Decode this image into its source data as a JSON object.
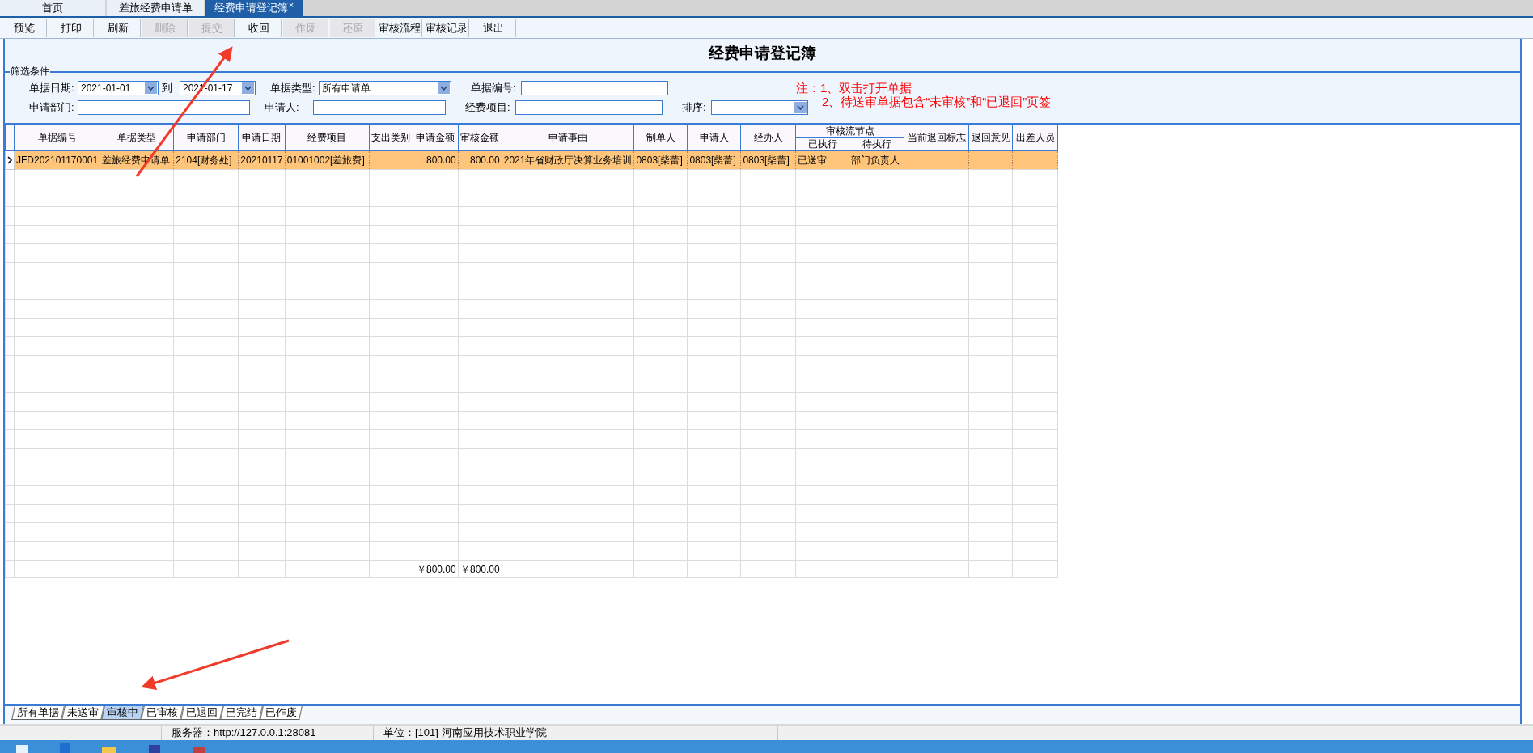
{
  "tabs": [
    {
      "label": "首页",
      "selected": false
    },
    {
      "label": "差旅经费申请单",
      "selected": false
    },
    {
      "label": "经费申请登记簿",
      "selected": true,
      "close": "×"
    }
  ],
  "toolbar": [
    {
      "label": "预览",
      "disabled": false
    },
    {
      "label": "打印",
      "disabled": false
    },
    {
      "label": "刷新",
      "disabled": false
    },
    {
      "label": "删除",
      "disabled": true
    },
    {
      "label": "提交",
      "disabled": true
    },
    {
      "label": "收回",
      "disabled": false
    },
    {
      "label": "作废",
      "disabled": true
    },
    {
      "label": "还原",
      "disabled": true
    },
    {
      "label": "审核流程",
      "disabled": false
    },
    {
      "label": "审核记录",
      "disabled": false
    },
    {
      "label": "退出",
      "disabled": false
    }
  ],
  "title": "经费申请登记簿",
  "filter": {
    "legend": "筛选条件",
    "fields": [
      {
        "label": "单据日期:",
        "kind": "date",
        "value": "2021-01-01"
      },
      {
        "label": "到",
        "kind": "date",
        "value": "2021-01-17"
      },
      {
        "label": "单据类型:",
        "kind": "select",
        "value": "所有申请单"
      },
      {
        "label": "单据编号:",
        "kind": "text"
      },
      {
        "label": "申请部门:",
        "kind": "text"
      },
      {
        "label": "申请人:",
        "kind": "text"
      },
      {
        "label": "经费项目:",
        "kind": "text"
      },
      {
        "label": "排序:",
        "kind": "select"
      }
    ],
    "notes": [
      "注：1、双击打开单据",
      "2、待送审单据包含“未审核”和“已退回”页签"
    ]
  },
  "table": {
    "columns": [
      {
        "label": "单据编号"
      },
      {
        "label": "单据类型"
      },
      {
        "label": "申请部门"
      },
      {
        "label": "申请日期"
      },
      {
        "label": "经费项目"
      },
      {
        "label": "支出类别"
      },
      {
        "label": "申请金额"
      },
      {
        "label": "审核金额"
      },
      {
        "label": "申请事由"
      },
      {
        "label": "制单人"
      },
      {
        "label": "申请人"
      },
      {
        "label": "经办人"
      },
      {
        "label": "审核流节点",
        "children": [
          {
            "label": "已执行"
          },
          {
            "label": "待执行"
          }
        ]
      },
      {
        "label": "当前退回标志"
      },
      {
        "label": "退回意见"
      },
      {
        "label": "出差人员"
      }
    ],
    "rows": [
      {
        "selected": true,
        "doc_no": "JFD202101170001",
        "doc_type": "差旅经费申请单",
        "department": "2104[财务处]",
        "date": "20210117",
        "fund_item": "01001002[差旅费]",
        "amount": "800.00",
        "approved_amount": "800.00",
        "reason": "2021年省财政厅决算业务培训",
        "creator": "0803[柴蕾]",
        "applicant": "0803[柴蕾]",
        "handler": "0803[柴蕾]",
        "executed": "已送审",
        "pending": "部门负责人"
      }
    ],
    "totals": {
      "amount": "￥800.00",
      "approved_amount": "￥800.00"
    }
  },
  "bottom_tabs": [
    {
      "label": "所有单据",
      "selected": false
    },
    {
      "label": "未送审",
      "selected": false
    },
    {
      "label": "审核中",
      "selected": true
    },
    {
      "label": "已审核",
      "selected": false
    },
    {
      "label": "已退回",
      "selected": false
    },
    {
      "label": "已完结",
      "selected": false
    },
    {
      "label": "已作废",
      "selected": false
    }
  ],
  "status_bar": [
    "服务器：http://127.0.0.1:28081",
    "单位：[101] 河南应用技术职业学院"
  ]
}
